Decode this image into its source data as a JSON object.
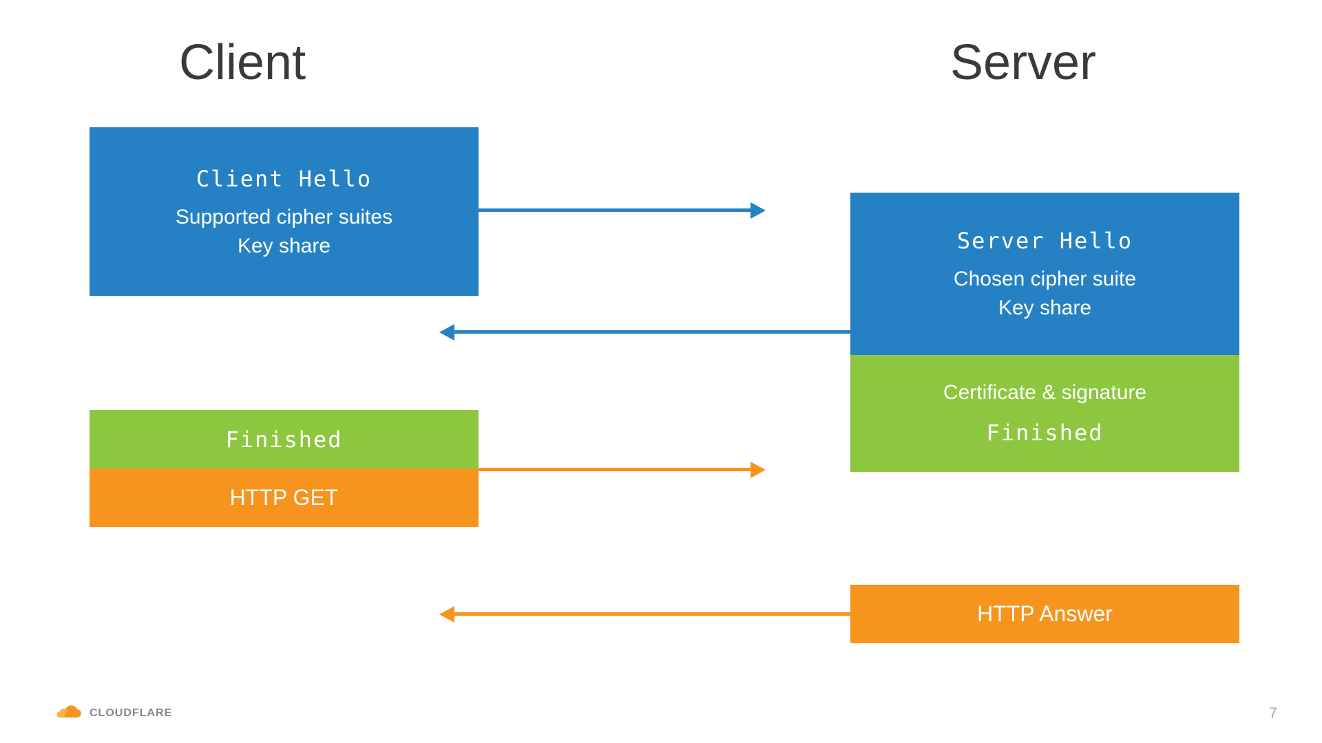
{
  "titles": {
    "client": "Client",
    "server": "Server"
  },
  "boxes": {
    "client_hello": {
      "title": "Client Hello",
      "line1": "Supported cipher suites",
      "line2": "Key share"
    },
    "server_hello": {
      "title": "Server Hello",
      "line1": "Chosen cipher suite",
      "line2": "Key share"
    },
    "server_cert": {
      "line1": "Certificate & signature",
      "line2": "Finished"
    },
    "client_finished": "Finished",
    "http_get": "HTTP GET",
    "http_answer": "HTTP Answer"
  },
  "logo": {
    "text": "CLOUDFLARE"
  },
  "page_number": "7",
  "colors": {
    "blue": "#2581c4",
    "green": "#8dc63f",
    "orange": "#f7941e"
  }
}
